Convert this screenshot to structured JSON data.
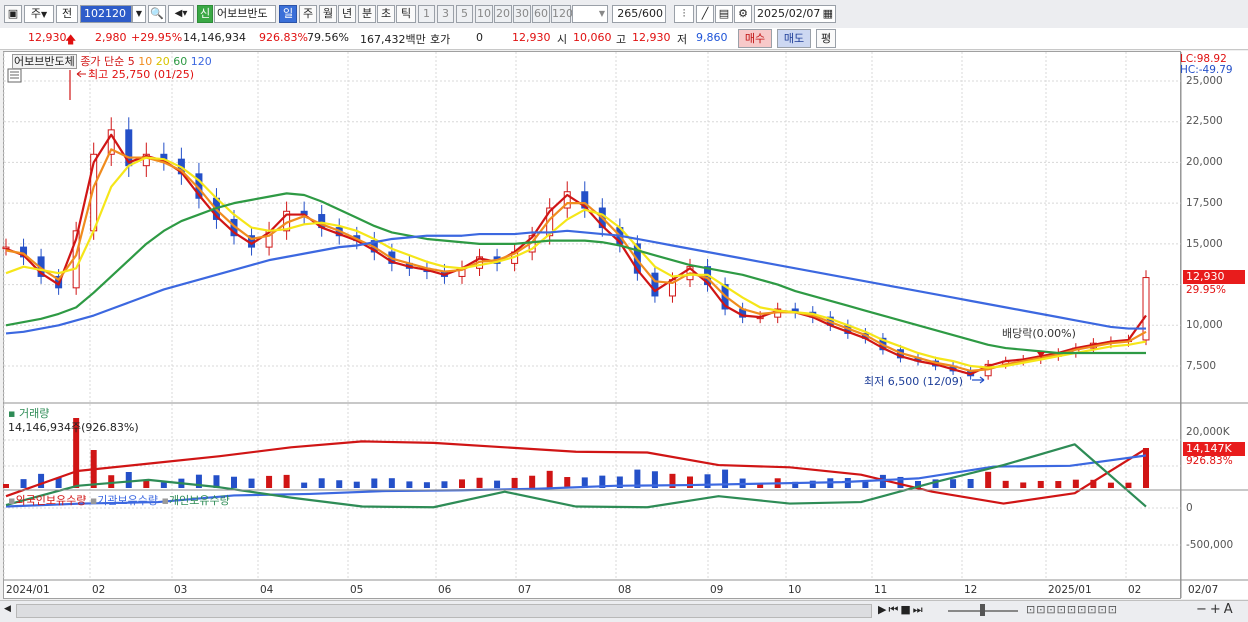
{
  "toolbar": {
    "period_unit": "주",
    "prev_label": "전",
    "stock_code": "102120",
    "badge_new": "신",
    "stock_name": "어보브반도",
    "periods": [
      "일",
      "주",
      "월",
      "년",
      "분",
      "초",
      "틱"
    ],
    "active_period": "일",
    "numbers": [
      "1",
      "3",
      "5",
      "10",
      "20",
      "30",
      "60",
      "120"
    ],
    "count_value": "265",
    "count_max": "/600",
    "date": "2025/02/07"
  },
  "quote": {
    "price": "12,930",
    "change": "2,980",
    "change_pct": "+29.95%",
    "volume": "14,146,934",
    "volume_pct": "926.83%",
    "turnover": "79.56%",
    "amount": "167,432백만",
    "hoga_label": "호가",
    "hoga_value": "0",
    "hoga_price": "12,930",
    "open_label": "시",
    "open": "10,060",
    "high_label": "고",
    "high": "12,930",
    "low_label": "저",
    "low": "9,860",
    "buy_label": "매수",
    "sell_label": "매도",
    "eval_label": "평"
  },
  "price_panel": {
    "stock_label": "어보브반도체",
    "ma_title": "종가 단순",
    "ma_periods": [
      "5",
      "10",
      "20",
      "60",
      "120"
    ],
    "ma_colors": [
      "#d01515",
      "#f08c1e",
      "#f5e619",
      "#2e9a44",
      "#3c68e0"
    ],
    "high_annotation": "최고 25,750 (01/25)",
    "low_annotation": "최저 6,500 (12/09)",
    "dividend_annotation": "배당락(0.00%)",
    "lc": "LC:98.92",
    "hc": "HC:-49.79",
    "price_tag": "12,930",
    "price_tag_pct": "29.95%",
    "y_ticks": [
      "25,000",
      "22,500",
      "20,000",
      "17,500",
      "15,000",
      "12,500",
      "10,000",
      "7,500"
    ]
  },
  "volume_panel": {
    "title": "거래량",
    "readout": "14,146,934주(926.83%)",
    "y_ticks": [
      "20,000K"
    ],
    "tag": "14,147K",
    "tag_pct": "926.83%"
  },
  "holding_panel": {
    "series": [
      {
        "name": "외국인보유수량",
        "color": "#d01515"
      },
      {
        "name": "기관보유수량",
        "color": "#3c68e0"
      },
      {
        "name": "개인보유수량",
        "color": "#2e8c56"
      }
    ],
    "y_ticks": [
      "0",
      "-500,000"
    ]
  },
  "x_axis": {
    "labels": [
      "2024/01",
      "02",
      "03",
      "04",
      "05",
      "06",
      "07",
      "08",
      "09",
      "10",
      "11",
      "12",
      "2025/01",
      "02",
      "02/07"
    ]
  },
  "chart_data": {
    "type": "candlestick",
    "title": "어보브반도체",
    "ylim": [
      6000,
      26500
    ],
    "y_ticks": [
      7500,
      10000,
      12500,
      15000,
      17500,
      20000,
      22500,
      25000
    ],
    "x_categories": [
      "2024/01",
      "02",
      "03",
      "04",
      "05",
      "06",
      "07",
      "08",
      "09",
      "10",
      "11",
      "12",
      "2025/01",
      "02"
    ],
    "close_series": [
      14800,
      14200,
      13000,
      12300,
      15800,
      20500,
      22000,
      19800,
      20500,
      20200,
      19300,
      17800,
      16500,
      15500,
      14800,
      15800,
      17000,
      16800,
      16000,
      15500,
      15200,
      14500,
      13800,
      13500,
      13300,
      13000,
      13500,
      14200,
      13800,
      14500,
      15500,
      17200,
      18200,
      17200,
      16000,
      15000,
      13200,
      11800,
      12800,
      13600,
      12500,
      11000,
      10500,
      10500,
      11000,
      10800,
      10500,
      10000,
      9500,
      9200,
      8500,
      8000,
      7800,
      7500,
      7200,
      6900,
      7600,
      7800,
      7900,
      8100,
      8300,
      8600,
      8900,
      9000,
      9100,
      12930
    ],
    "series": [
      {
        "name": "5",
        "values": [
          14700,
          14300,
          13200,
          12500,
          15300,
          20000,
          21700,
          20000,
          20400,
          20100,
          19400,
          18000,
          16700,
          15700,
          15000,
          15700,
          16800,
          16800,
          16000,
          15600,
          15200,
          14600,
          13900,
          13600,
          13400,
          13100,
          13500,
          14100,
          13900,
          14500,
          15400,
          17000,
          18000,
          17300,
          16100,
          15100,
          13400,
          12100,
          12800,
          13500,
          12600,
          11200,
          10600,
          10500,
          10900,
          10800,
          10500,
          10000,
          9600,
          9200,
          8600,
          8100,
          7800,
          7600,
          7300,
          7000,
          7500,
          7800,
          7900,
          8100,
          8300,
          8600,
          8800,
          9000,
          9100,
          10600
        ]
      },
      {
        "name": "10",
        "values": [
          14600,
          14400,
          13500,
          12800,
          14300,
          18500,
          20800,
          20300,
          20300,
          20000,
          19500,
          18400,
          17100,
          16100,
          15300,
          15500,
          16300,
          16700,
          16200,
          15800,
          15300,
          14800,
          14100,
          13800,
          13500,
          13300,
          13400,
          13900,
          14000,
          14400,
          15100,
          16500,
          17500,
          17500,
          16600,
          15500,
          14000,
          12700,
          12600,
          13200,
          12900,
          11800,
          11000,
          10700,
          10800,
          10800,
          10600,
          10200,
          9800,
          9400,
          8800,
          8300,
          8000,
          7700,
          7500,
          7200,
          7300,
          7600,
          7800,
          8000,
          8200,
          8500,
          8700,
          8900,
          9000,
          9600
        ]
      },
      {
        "name": "20",
        "values": [
          13200,
          13600,
          13400,
          13200,
          13500,
          15800,
          18500,
          19800,
          20300,
          20200,
          19700,
          18900,
          17800,
          16800,
          16000,
          15800,
          15900,
          16200,
          16300,
          16100,
          15800,
          15300,
          14700,
          14300,
          13900,
          13600,
          13500,
          13700,
          13900,
          14200,
          14700,
          15600,
          16500,
          17100,
          16800,
          16000,
          14800,
          13600,
          13000,
          13100,
          13100,
          12400,
          11700,
          11100,
          10900,
          10800,
          10700,
          10400,
          10000,
          9600,
          9100,
          8700,
          8300,
          8000,
          7800,
          7500,
          7400,
          7500,
          7700,
          7900,
          8100,
          8300,
          8500,
          8700,
          8800,
          9000
        ]
      },
      {
        "name": "60",
        "values": [
          10000,
          10200,
          10400,
          10700,
          11100,
          12000,
          13000,
          14000,
          15000,
          15800,
          16400,
          16800,
          17200,
          17500,
          17700,
          17900,
          18100,
          18000,
          17600,
          17100,
          16600,
          16100,
          15700,
          15500,
          15300,
          15200,
          15100,
          15000,
          15000,
          15000,
          15100,
          15200,
          15200,
          15200,
          15100,
          14900,
          14600,
          14300,
          14000,
          13700,
          13500,
          13300,
          13100,
          12800,
          12500,
          12100,
          11800,
          11500,
          11200,
          10900,
          10600,
          10300,
          10000,
          9700,
          9400,
          9100,
          8800,
          8600,
          8500,
          8400,
          8300,
          8300,
          8300,
          8300,
          8300,
          8300
        ]
      },
      {
        "name": "120",
        "values": [
          9500,
          9600,
          9800,
          10000,
          10300,
          10600,
          11000,
          11400,
          11800,
          12200,
          12500,
          12800,
          13100,
          13400,
          13700,
          14000,
          14200,
          14400,
          14600,
          14800,
          14900,
          15100,
          15300,
          15400,
          15500,
          15500,
          15500,
          15600,
          15600,
          15600,
          15700,
          15700,
          15800,
          15700,
          15600,
          15500,
          15300,
          15100,
          14900,
          14700,
          14500,
          14300,
          14100,
          13900,
          13700,
          13500,
          13300,
          13100,
          12900,
          12700,
          12500,
          12300,
          12100,
          11900,
          11700,
          11500,
          11300,
          11100,
          10900,
          10700,
          10500,
          10300,
          10100,
          9900,
          9800,
          9800
        ]
      }
    ]
  }
}
